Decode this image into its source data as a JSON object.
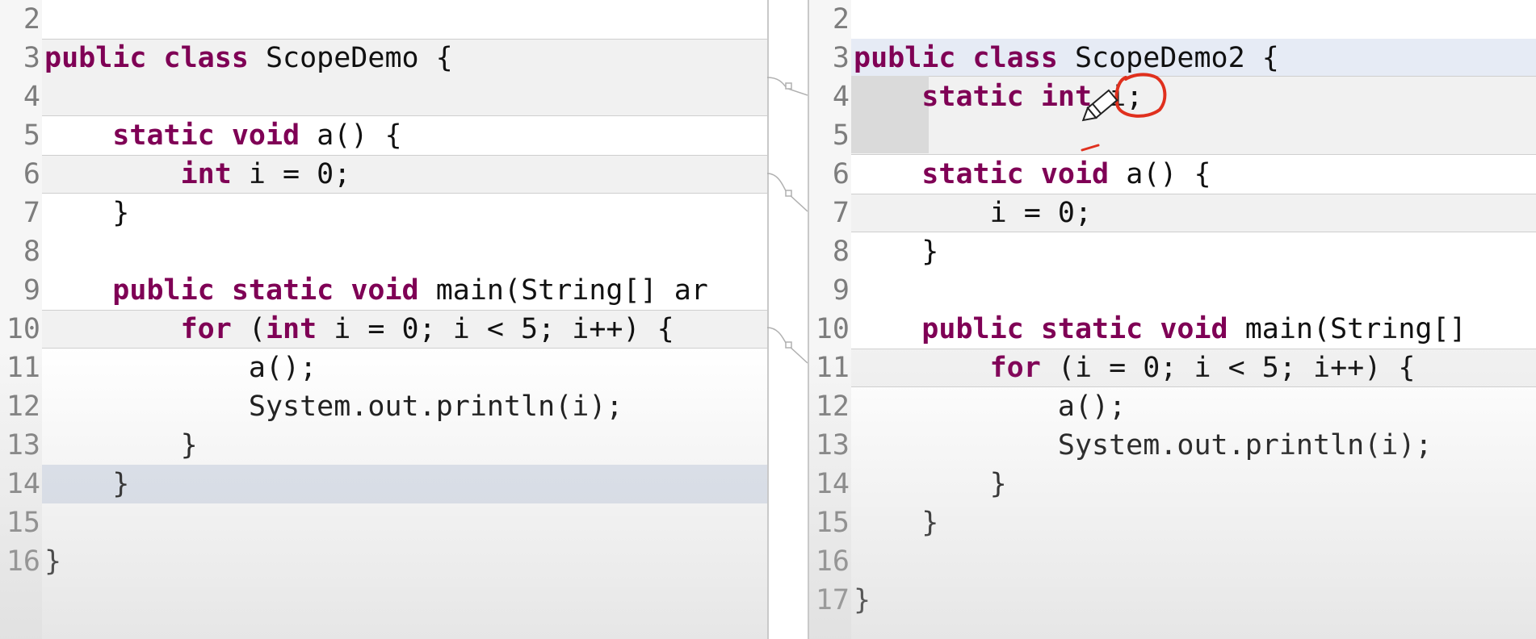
{
  "left_editor": {
    "lines": [
      {
        "num": "2",
        "text": ""
      },
      {
        "num": "3",
        "text": "public class ScopeDemo {"
      },
      {
        "num": "4",
        "text": ""
      },
      {
        "num": "5",
        "text": "    static void a() {"
      },
      {
        "num": "6",
        "text": "        int i = 0;"
      },
      {
        "num": "7",
        "text": "    }"
      },
      {
        "num": "8",
        "text": ""
      },
      {
        "num": "9",
        "text": "    public static void main(String[] ar"
      },
      {
        "num": "10",
        "text": "        for (int i = 0; i < 5; i++) {"
      },
      {
        "num": "11",
        "text": "            a();"
      },
      {
        "num": "12",
        "text": "            System.out.println(i);"
      },
      {
        "num": "13",
        "text": "        }"
      },
      {
        "num": "14",
        "text": "    }"
      },
      {
        "num": "15",
        "text": ""
      },
      {
        "num": "16",
        "text": "}"
      }
    ]
  },
  "right_editor": {
    "lines": [
      {
        "num": "2",
        "text": ""
      },
      {
        "num": "3",
        "text": "public class ScopeDemo2 {"
      },
      {
        "num": "4",
        "text": "    static int i;"
      },
      {
        "num": "5",
        "text": ""
      },
      {
        "num": "6",
        "text": "    static void a() {"
      },
      {
        "num": "7",
        "text": "        i = 0;"
      },
      {
        "num": "8",
        "text": "    }"
      },
      {
        "num": "9",
        "text": ""
      },
      {
        "num": "10",
        "text": "    public static void main(String[]"
      },
      {
        "num": "11",
        "text": "        for (i = 0; i < 5; i++) {"
      },
      {
        "num": "12",
        "text": "            a();"
      },
      {
        "num": "13",
        "text": "            System.out.println(i);"
      },
      {
        "num": "14",
        "text": "        }"
      },
      {
        "num": "15",
        "text": "    }"
      },
      {
        "num": "16",
        "text": ""
      },
      {
        "num": "17",
        "text": "}"
      }
    ]
  },
  "keywords": [
    "public",
    "class",
    "static",
    "void",
    "int",
    "for"
  ],
  "colors": {
    "keyword": "#7f0055",
    "line_number": "#7d7d7d",
    "annotation": "#e0301e",
    "selection_gray": "#dcdcdc"
  }
}
